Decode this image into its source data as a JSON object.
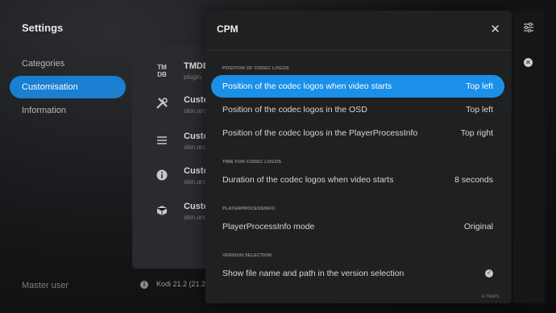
{
  "sidebar": {
    "title": "Settings",
    "items": [
      {
        "label": "Categories"
      },
      {
        "label": "Customisation"
      },
      {
        "label": "Information"
      }
    ],
    "footer": "Master user"
  },
  "background_list": {
    "rows": [
      {
        "icon": "tmdb-icon",
        "icon_text": "TM\nDB",
        "title": "TMDB",
        "sub": "plugin."
      },
      {
        "icon": "tools-icon",
        "title": "Custo",
        "sub": "skin.arc"
      },
      {
        "icon": "list-icon",
        "title": "Custo",
        "sub": "skin.arc"
      },
      {
        "icon": "info-icon",
        "title": "Custo",
        "sub": "skin.arc"
      },
      {
        "icon": "box-icon",
        "title": "Custo",
        "sub": "skin.arc"
      }
    ],
    "kodi_version": "Kodi 21.2 (21.2."
  },
  "dialog": {
    "title": "CPM",
    "close_glyph": "✕",
    "sections": [
      {
        "header": "POSITION OF CODEC LOGOS"
      },
      {
        "header": "TIME FOR CODEC LOGOS"
      },
      {
        "header": "PLAYERPROCESSINFO"
      },
      {
        "header": "VERSION SELECTION"
      }
    ],
    "rows": [
      {
        "label": "Position of the codec logos when video starts",
        "value": "Top left",
        "focused": true
      },
      {
        "label": "Position of the codec logos in the OSD",
        "value": "Top left"
      },
      {
        "label": "Position of the codec logos in the PlayerProcessInfo",
        "value": "Top right"
      },
      {
        "label": "Duration of the codec logos when video starts",
        "value": "8 seconds"
      },
      {
        "label": "PlayerProcessInfo mode",
        "value": "Original"
      },
      {
        "label": "Show file name and path in the version selection",
        "value": "",
        "checked": true
      }
    ],
    "items_count": "6 ITEMS"
  },
  "rail": {
    "icons": [
      "sliders-icon",
      "close-circle-icon"
    ]
  },
  "colors": {
    "accent": "#1a90e8",
    "nav_active": "#1a7fd1",
    "dialog_bg": "#1f2022"
  }
}
